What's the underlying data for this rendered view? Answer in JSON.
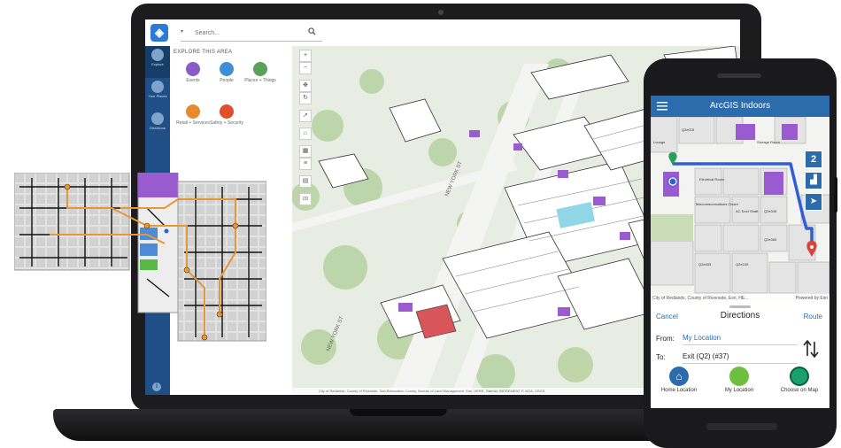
{
  "laptop": {
    "search": {
      "placeholder": "Search..."
    },
    "sidebar": {
      "items": [
        {
          "label": "Explore"
        },
        {
          "label": "Your Places"
        },
        {
          "label": "Directions"
        }
      ]
    },
    "explore": {
      "title": "EXPLORE THIS AREA",
      "categories": [
        {
          "label": "Events",
          "color": "#8a5cc7"
        },
        {
          "label": "People",
          "color": "#3f8fd8"
        },
        {
          "label": "Places + Things",
          "color": "#5aa25a"
        },
        {
          "label": "Retail + Services",
          "color": "#e88a2c"
        },
        {
          "label": "Safety + Security",
          "color": "#e0502d"
        }
      ]
    },
    "map": {
      "street_label_1": "NEW YORK ST",
      "street_label_2": "NEW YORK ST",
      "attribution": "City of Redlands, County of Riverside, San Bernardino County, Bureau of Land Management, Esri, HERE, Garmin, INCREMENT P, NGA, USGS",
      "controls": {
        "zoom_in": "+",
        "zoom_out": "−",
        "view_2d": "2D"
      }
    }
  },
  "phone": {
    "app_title": "ArcGIS Indoors",
    "floor_level": "2",
    "map": {
      "room_labels": [
        "Q2e015",
        "Storage Room",
        "Lounge",
        "Electrical Room",
        "Telecommunications Closet",
        "AC Duct Shaft",
        "Q2e345",
        "Q2e365",
        "Q2e440",
        "Q2e405",
        "Q2e100"
      ]
    },
    "attribution_left": "City of Redlands, County of Riverside, Esri, HE...",
    "attribution_right": "Powered by Esri",
    "directions": {
      "cancel": "Cancel",
      "title": "Directions",
      "route": "Route",
      "from_label": "From:",
      "from_value": "My Location",
      "to_label": "To:",
      "to_value": "Exit (Q2) (#37)"
    },
    "actions": [
      {
        "label": "Home Location",
        "color": "#2c6cad"
      },
      {
        "label": "My Location",
        "color": "#6fbf3f"
      },
      {
        "label": "Choose on Map",
        "color": "#1aa06a"
      }
    ]
  },
  "colors": {
    "brand_blue": "#1f4f86",
    "accent_purple": "#9b5bd0",
    "route_blue": "#2f5fd6",
    "route_orange": "#e8963a"
  }
}
